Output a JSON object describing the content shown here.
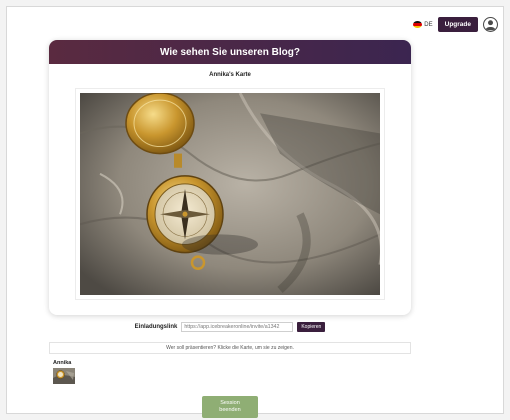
{
  "topbar": {
    "language": "DE",
    "upgrade_label": "Upgrade"
  },
  "card": {
    "title": "Wie sehen Sie unseren Blog?",
    "subtitle": "Annika's Karte"
  },
  "invite": {
    "label": "Einladungslink",
    "url": "https://app.icebreakeronline/invite/a1342",
    "copy_label": "Kopieren"
  },
  "hint": "Wer soll präsentieren? Klicke die Karte, um sie zu zeigen.",
  "participants": [
    {
      "name": "Annika"
    }
  ],
  "end_session": {
    "line1": "Session",
    "line2": "beenden"
  },
  "colors": {
    "header_gradient_start": "#5a2a40",
    "header_gradient_end": "#3b2550",
    "primary_button": "#3a1f3d",
    "end_button": "#8fae74"
  },
  "icons": {
    "flag": "flag-de-icon",
    "avatar": "user-avatar-icon",
    "photo": "compass-on-rocks-image"
  }
}
